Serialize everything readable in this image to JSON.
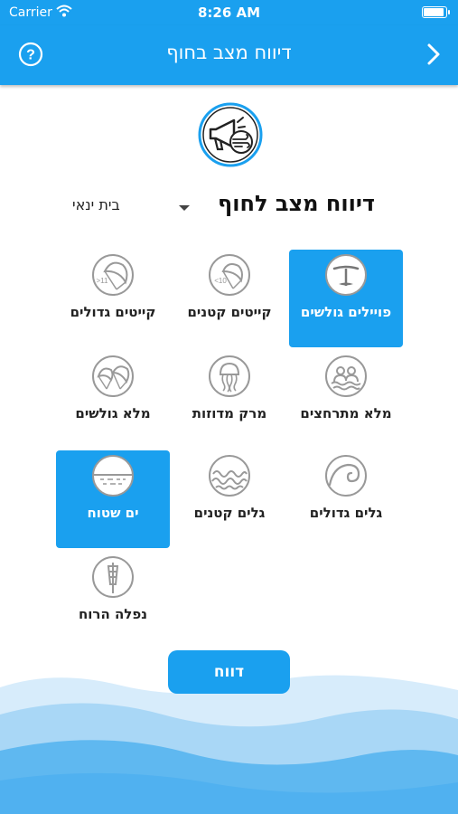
{
  "status_bar": {
    "carrier": "Carrier",
    "time": "8:26 AM",
    "battery_level": 0.95
  },
  "nav": {
    "title": "דיווח מצב בחוף",
    "help_icon": "question-circle-icon",
    "back_icon": "chevron-right-icon"
  },
  "header": {
    "report_title": "דיווח מצב לחוף",
    "beach": "בית ינאי"
  },
  "options": [
    {
      "label": "פויילים גולשים",
      "icon": "hydrofoil-icon",
      "selected": true
    },
    {
      "label": "קייטים קטנים",
      "icon": "small-kites-icon",
      "selected": false
    },
    {
      "label": "קייטים גדולים",
      "icon": "large-kites-icon",
      "selected": false
    },
    {
      "label": "מלא מתרחצים",
      "icon": "swimmers-icon",
      "selected": false
    },
    {
      "label": "מרק מדוזות",
      "icon": "jellyfish-icon",
      "selected": false
    },
    {
      "label": "מלא גולשים",
      "icon": "many-kites-icon",
      "selected": false
    },
    {
      "label": "גלים גדולים",
      "icon": "big-wave-icon",
      "selected": false
    },
    {
      "label": "גלים קטנים",
      "icon": "small-waves-icon",
      "selected": false
    },
    {
      "label": "ים שטוח",
      "icon": "flat-sea-icon",
      "selected": true
    },
    {
      "label": "נפלה הרוח",
      "icon": "windsock-icon",
      "selected": false
    }
  ],
  "icon_texts": {
    "small_kites": "<10",
    "large_kites": ">11"
  },
  "report_button": "דווח",
  "colors": {
    "primary": "#1aa0ef",
    "wave_light": "#d7ecfb",
    "wave_mid": "#a9d7f6",
    "wave_dark": "#5fb8f0"
  }
}
